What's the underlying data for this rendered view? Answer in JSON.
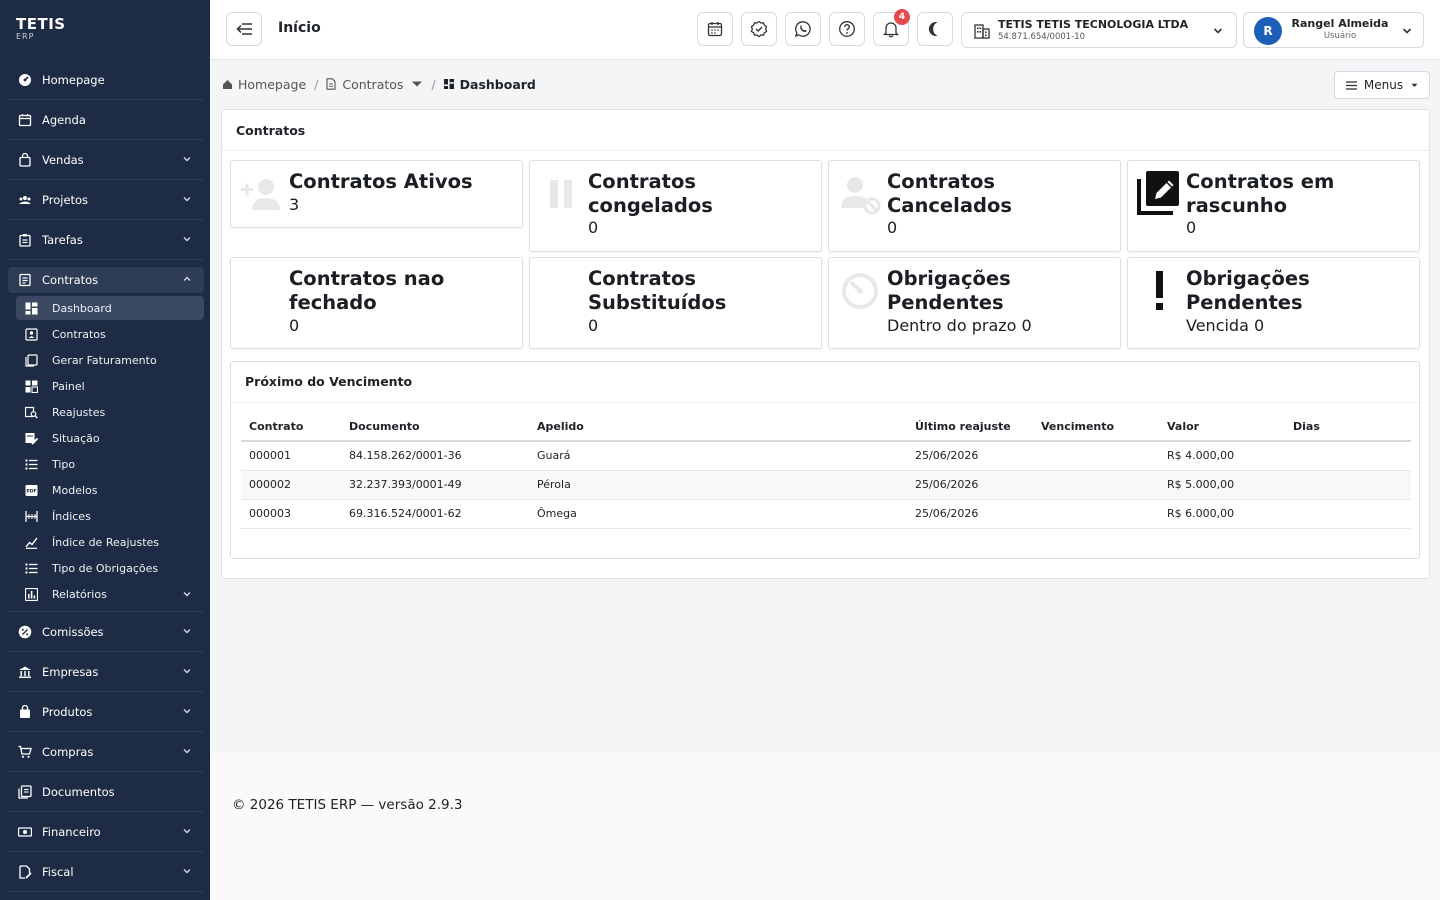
{
  "brand": {
    "name": "TETIS",
    "sub": "ERP"
  },
  "sidebar": {
    "items": [
      {
        "label": "Homepage"
      },
      {
        "label": "Agenda"
      },
      {
        "label": "Vendas"
      },
      {
        "label": "Projetos"
      },
      {
        "label": "Tarefas"
      },
      {
        "label": "Contratos"
      },
      {
        "label": "Comissões"
      },
      {
        "label": "Empresas"
      },
      {
        "label": "Produtos"
      },
      {
        "label": "Compras"
      },
      {
        "label": "Documentos"
      },
      {
        "label": "Financeiro"
      },
      {
        "label": "Fiscal"
      }
    ],
    "contratos_sub": [
      {
        "label": "Dashboard"
      },
      {
        "label": "Contratos"
      },
      {
        "label": "Gerar Faturamento"
      },
      {
        "label": "Painel"
      },
      {
        "label": "Reajustes"
      },
      {
        "label": "Situação"
      },
      {
        "label": "Tipo"
      },
      {
        "label": "Modelos"
      },
      {
        "label": "Índices"
      },
      {
        "label": "Índice de Reajustes"
      },
      {
        "label": "Tipo de Obrigações"
      },
      {
        "label": "Relatórios"
      }
    ]
  },
  "header": {
    "title": "Início",
    "notifications_count": "4",
    "company": {
      "name": "TETIS TETIS TECNOLOGIA LTDA",
      "cnpj": "54.871.654/0001-10"
    },
    "user": {
      "initial": "R",
      "name": "Rangel Almeida",
      "role": "Usuário"
    }
  },
  "breadcrumb": {
    "home": "Homepage",
    "section": "Contratos",
    "current": "Dashboard",
    "menus": "Menus"
  },
  "panel": {
    "title": "Contratos",
    "cards": [
      {
        "title": "Contratos Ativos",
        "value": "3"
      },
      {
        "title": "Contratos congelados",
        "value": "0"
      },
      {
        "title": "Contratos Cancelados",
        "value": "0"
      },
      {
        "title": "Contratos em rascunho",
        "value": "0"
      },
      {
        "title": "Contratos nao fechado",
        "value": "0"
      },
      {
        "title": "Contratos Substituídos",
        "value": "0"
      },
      {
        "title": "Obrigações Pendentes",
        "value": "Dentro do prazo 0"
      },
      {
        "title": "Obrigações Pendentes",
        "value": "Vencida 0"
      }
    ]
  },
  "table": {
    "title": "Próximo do Vencimento",
    "columns": [
      "Contrato",
      "Documento",
      "Apelido",
      "Último reajuste",
      "Vencimento",
      "Valor",
      "Dias"
    ],
    "rows": [
      {
        "contrato": "000001",
        "documento": "84.158.262/0001-36",
        "apelido": "Guará",
        "reajuste": "25/06/2026",
        "vencimento": "",
        "valor": "R$ 4.000,00",
        "dias": ""
      },
      {
        "contrato": "000002",
        "documento": "32.237.393/0001-49",
        "apelido": "Pérola",
        "reajuste": "25/06/2026",
        "vencimento": "",
        "valor": "R$ 5.000,00",
        "dias": ""
      },
      {
        "contrato": "000003",
        "documento": "69.316.524/0001-62",
        "apelido": "Ômega",
        "reajuste": "25/06/2026",
        "vencimento": "",
        "valor": "R$ 6.000,00",
        "dias": ""
      }
    ]
  },
  "footer": {
    "text": "© 2026 TETIS ERP — versão 2.9.3"
  }
}
